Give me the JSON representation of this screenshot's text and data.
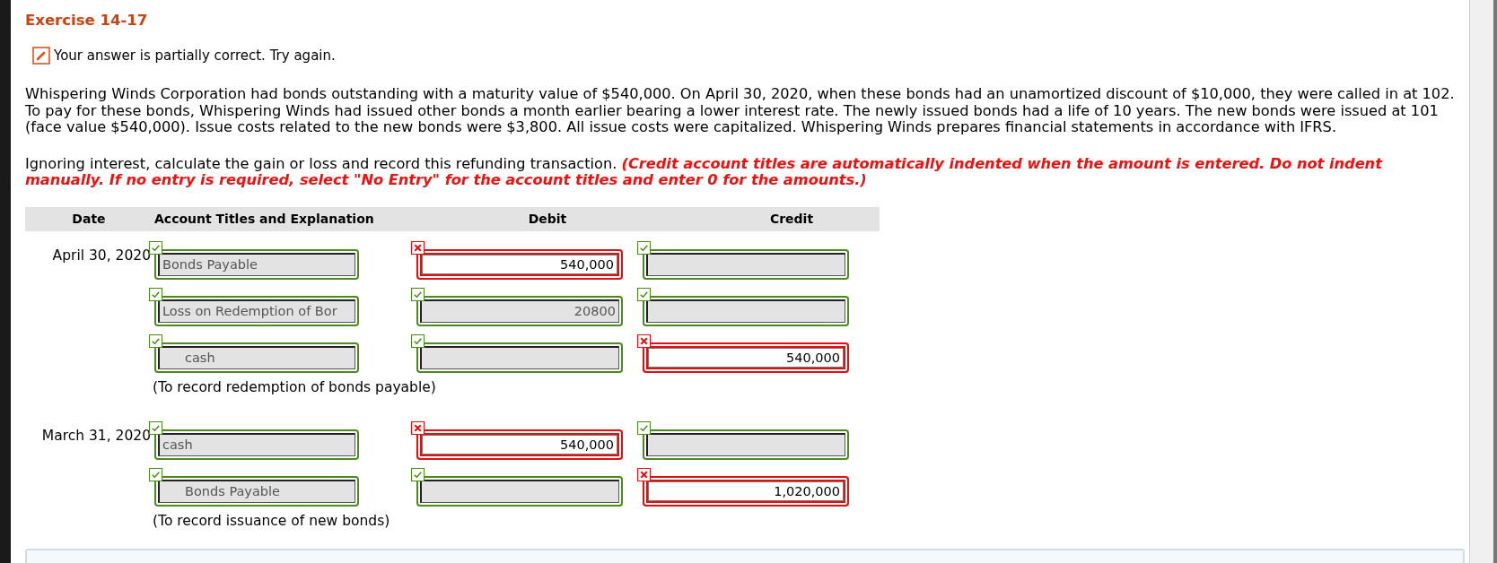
{
  "title": "Exercise 14-17",
  "feedback": {
    "kind": "partial",
    "message": "Your answer is partially correct.  Try again."
  },
  "problem": "Whispering Winds Corporation had bonds outstanding with a maturity value of $540,000. On April 30, 2020, when these bonds had an unamortized discount of $10,000, they were called in at 102. To pay for these bonds, Whispering Winds had issued other bonds a month earlier bearing a lower interest rate. The newly issued bonds had a life of 10 years. The new bonds were issued at 101 (face value $540,000). Issue costs related to the new bonds were $3,800. All issue costs were capitalized. Whispering Winds prepares financial statements in accordance with IFRS.",
  "instruction": "Ignoring interest, calculate the gain or loss and record this refunding transaction.",
  "note": "(Credit account titles are automatically indented when the amount is entered. Do not indent manually. If no entry is required, select \"No Entry\" for the account titles and enter 0 for the amounts.)",
  "table": {
    "columns": [
      "Date",
      "Account Titles and Explanation",
      "Debit",
      "Credit"
    ],
    "entries": [
      {
        "date": "April 30, 2020",
        "explanation": "(To record redemption of bonds payable)",
        "lines": [
          {
            "account": {
              "value": "Bonds Payable",
              "indented": false,
              "correct": true
            },
            "debit": {
              "value": "540,000",
              "correct": false
            },
            "credit": {
              "correct": true
            }
          },
          {
            "account": {
              "value": "Loss on Redemption of Bor",
              "indented": false,
              "correct": true
            },
            "debit": {
              "value": "20800",
              "correct": true
            },
            "credit": {
              "correct": true
            }
          },
          {
            "account": {
              "value": "cash",
              "indented": true,
              "correct": true
            },
            "debit": {
              "correct": true
            },
            "credit": {
              "value": "540,000",
              "correct": false
            }
          }
        ]
      },
      {
        "date": "March 31, 2020",
        "explanation": "(To record issuance of new bonds)",
        "lines": [
          {
            "account": {
              "value": "cash",
              "indented": false,
              "correct": true
            },
            "debit": {
              "value": "540,000",
              "correct": false
            },
            "credit": {
              "correct": true
            }
          },
          {
            "account": {
              "value": "Bonds Payable",
              "indented": true,
              "correct": true
            },
            "debit": {
              "correct": true
            },
            "credit": {
              "value": "1,020,000",
              "correct": false
            }
          }
        ]
      }
    ]
  }
}
